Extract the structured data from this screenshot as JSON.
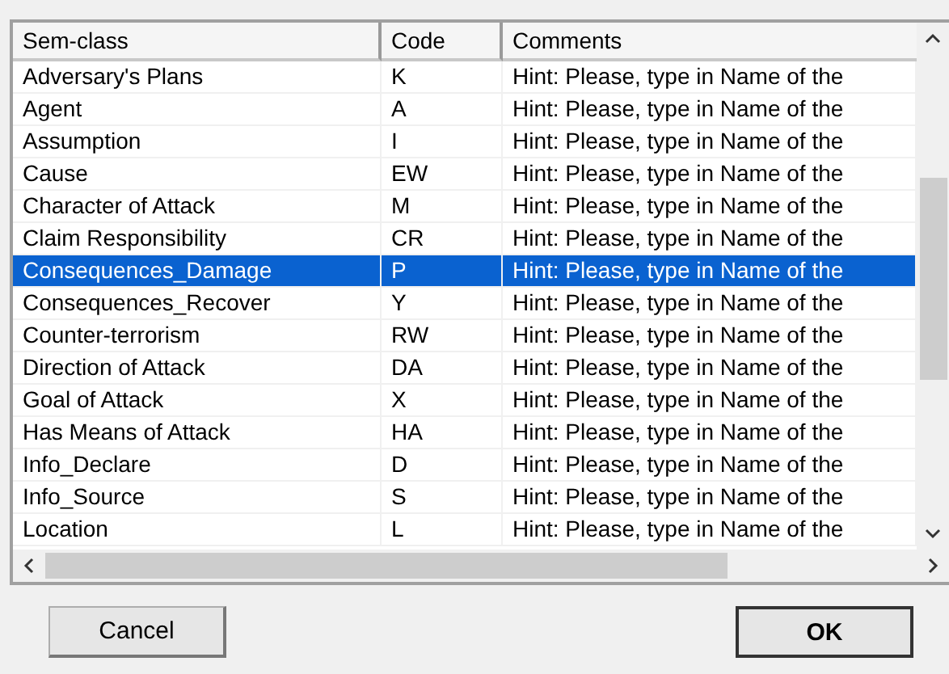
{
  "table": {
    "columns": [
      "Sem-class",
      "Code",
      "Comments"
    ],
    "rows": [
      {
        "sem_class": "Adversary's Plans",
        "code": "K",
        "comment": "Hint: Please, type in Name of the",
        "selected": false
      },
      {
        "sem_class": "Agent",
        "code": "A",
        "comment": "Hint: Please, type in Name of the",
        "selected": false
      },
      {
        "sem_class": "Assumption",
        "code": "I",
        "comment": "Hint: Please, type in Name of the",
        "selected": false
      },
      {
        "sem_class": "Cause",
        "code": "EW",
        "comment": "Hint: Please, type in Name of the",
        "selected": false
      },
      {
        "sem_class": "Character of Attack",
        "code": "M",
        "comment": "Hint: Please, type in Name of the",
        "selected": false
      },
      {
        "sem_class": "Claim Responsibility",
        "code": "CR",
        "comment": "Hint: Please, type in Name of the",
        "selected": false
      },
      {
        "sem_class": "Consequences_Damage",
        "code": "P",
        "comment": "Hint: Please, type in Name of the",
        "selected": true
      },
      {
        "sem_class": "Consequences_Recover",
        "code": "Y",
        "comment": "Hint: Please, type in Name of the",
        "selected": false
      },
      {
        "sem_class": "Counter-terrorism",
        "code": "RW",
        "comment": "Hint: Please, type in Name of the",
        "selected": false
      },
      {
        "sem_class": "Direction of Attack",
        "code": "DA",
        "comment": "Hint: Please, type in Name of the",
        "selected": false
      },
      {
        "sem_class": "Goal of Attack",
        "code": "X",
        "comment": "Hint: Please, type in Name of the",
        "selected": false
      },
      {
        "sem_class": "Has Means of Attack",
        "code": "HA",
        "comment": "Hint: Please, type in Name of the",
        "selected": false
      },
      {
        "sem_class": "Info_Declare",
        "code": "D",
        "comment": "Hint: Please, type in Name of the",
        "selected": false
      },
      {
        "sem_class": "Info_Source",
        "code": "S",
        "comment": "Hint: Please, type in Name of the",
        "selected": false
      },
      {
        "sem_class": "Location",
        "code": "L",
        "comment": "Hint: Please, type in Name of the",
        "selected": false
      }
    ]
  },
  "buttons": [
    {
      "label": "Cancel",
      "kind": "normal"
    },
    {
      "label": "OK",
      "kind": "default"
    }
  ]
}
